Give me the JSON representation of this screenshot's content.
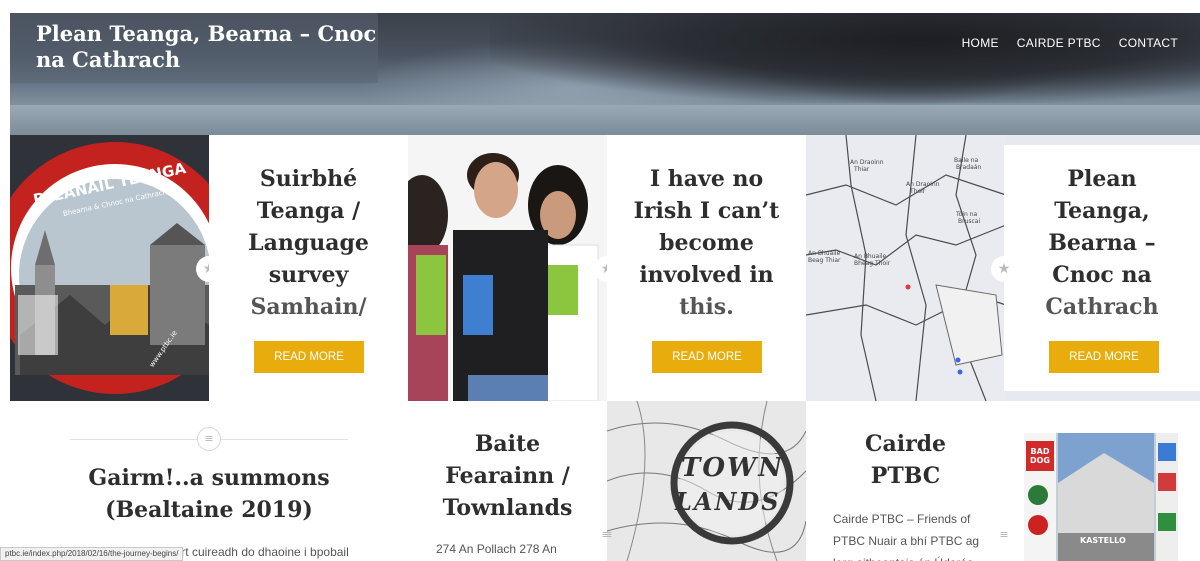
{
  "site": {
    "title": "Plean Teanga, Bearna – Cnoc na Cathrach"
  },
  "nav": [
    {
      "label": "HOME"
    },
    {
      "label": "CAIRDE PTBC"
    },
    {
      "label": "CONTACT"
    }
  ],
  "featured": [
    {
      "logo_text": "PLEANÁIL TEANGA",
      "logo_subtext": "Bhearna & Chnoc na Cathrach",
      "logo_url": "www.ptbc.ie",
      "title_lines": [
        "Suirbhé",
        "Teanga /",
        "Language",
        "survey"
      ],
      "title_cont": "Samhain/",
      "button": "READ MORE"
    },
    {
      "title_lines": [
        "I have no",
        "Irish I can’t",
        "become",
        "involved in"
      ],
      "title_cont": "this.",
      "button": "READ MORE"
    },
    {
      "title_lines": [
        "Plean",
        "Teanga,",
        "Bearna –",
        "Cnoc na"
      ],
      "title_cont": "Cathrach",
      "button": "READ MORE"
    }
  ],
  "map_labels": [
    "An Draoinn",
    "Thiar",
    "An Draoinn",
    "Thoir",
    "Baile na",
    "Bradaán",
    "Tóin na",
    "Bruscai",
    "An Bhuaile",
    "Beag Thiar",
    "An Bhuaile",
    "Bheag Thoir"
  ],
  "posts": [
    {
      "title_lines": [
        "Gairm!..a summons",
        "(Bealtaine 2019)"
      ],
      "excerpt": "Tá PTBC ag tabhairt cuireadh do dhaoine i bpobail"
    },
    {
      "title_lines": [
        "Baite",
        "Fearainn /",
        "Townlands"
      ],
      "excerpt": "274 An Pollach 278 An"
    },
    {
      "image_text_1": "TOWN",
      "image_text_2": "LANDS"
    },
    {
      "title_lines": [
        "Cairde",
        "PTBC"
      ],
      "excerpt_lines": [
        "Cairde PTBC – Friends of",
        "PTBC Nuair a bhí PTBC ag",
        "lorg aitheantais ón Údarás"
      ]
    }
  ],
  "collage": {
    "sign_text": "BAD DOG",
    "shop_text": "KASTELLO"
  },
  "status_url": "ptbc.ie/index.php/2018/02/16/the-journey-begins/",
  "icons": {
    "star": "star-icon",
    "post": "post-format-icon"
  },
  "colors": {
    "button": "#e8ad0c",
    "title": "#2e2e2e"
  }
}
